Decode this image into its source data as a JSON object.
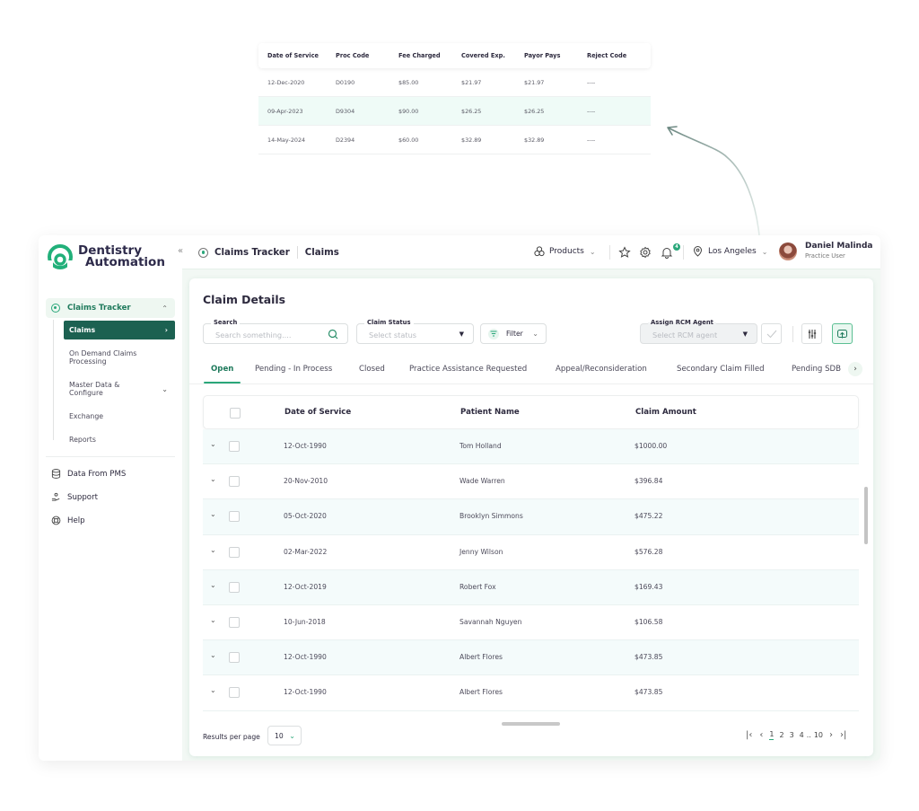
{
  "detail_table": {
    "headers": [
      "Date of Service",
      "Proc Code",
      "Fee Charged",
      "Covered Exp.",
      "Payor Pays",
      "Reject Code"
    ],
    "rows": [
      [
        "12-Dec-2020",
        "D0190",
        "$85.00",
        "$21.97",
        "$21.97",
        "----"
      ],
      [
        "09-Apr-2023",
        "D9304",
        "$90.00",
        "$26.25",
        "$26.25",
        "----"
      ],
      [
        "14-May-2024",
        "D2394",
        "$60.00",
        "$32.89",
        "$32.89",
        "----"
      ]
    ]
  },
  "brand": {
    "line1": "Dentistry",
    "line2": "Automation",
    "accent": "#2aa77a",
    "dark": "#1c6151"
  },
  "sidebar": {
    "collapse_label": "«",
    "group": {
      "label": "Claims Tracker",
      "chevron": "^"
    },
    "sub_items": [
      {
        "label": "Claims",
        "active": true,
        "chevron": ">"
      },
      {
        "label": "On Demand Claims Processing"
      },
      {
        "label": "Master Data & Configure",
        "chevron": "v"
      },
      {
        "label": "Exchange"
      },
      {
        "label": "Reports"
      }
    ],
    "links": [
      {
        "label": "Data From PMS",
        "icon": "database-icon"
      },
      {
        "label": "Support",
        "icon": "support-hand-icon"
      },
      {
        "label": "Help",
        "icon": "lifebuoy-icon"
      }
    ]
  },
  "header": {
    "breadcrumb": [
      "Claims Tracker",
      "Claims"
    ],
    "products_label": "Products",
    "notification_count": "4",
    "location": "Los Angeles",
    "user": {
      "name": "Daniel Malinda",
      "role": "Practice User"
    }
  },
  "main": {
    "title": "Claim Details",
    "search": {
      "legend": "Search",
      "placeholder": "Search something...."
    },
    "claim_status": {
      "legend": "Claim Status",
      "placeholder": "Select status"
    },
    "filter_label": "Filter",
    "rcm_agent": {
      "legend": "Assign RCM Agent",
      "placeholder": "Select RCM agent"
    },
    "tabs": [
      {
        "label": "Open",
        "active": true
      },
      {
        "label": "Pending - In Process"
      },
      {
        "label": "Closed"
      },
      {
        "label": "Practice Assistance Requested"
      },
      {
        "label": "Appeal/Reconsideration"
      },
      {
        "label": "Secondary Claim Filled"
      },
      {
        "label": "Pending SDB"
      }
    ],
    "table": {
      "headers": [
        "Date of Service",
        "Patient Name",
        "Claim Amount"
      ],
      "rows": [
        [
          "12-Oct-1990",
          "Tom Holland",
          "$1000.00"
        ],
        [
          "20-Nov-2010",
          "Wade Warren",
          "$396.84"
        ],
        [
          "05-Oct-2020",
          "Brooklyn Simmons",
          "$475.22"
        ],
        [
          "02-Mar-2022",
          "Jenny Wilson",
          "$576.28"
        ],
        [
          "12-Oct-2019",
          "Robert Fox",
          "$169.43"
        ],
        [
          "10-Jun-2018",
          "Savannah Nguyen",
          "$106.58"
        ],
        [
          "12-Oct-1990",
          "Albert Flores",
          "$473.85"
        ],
        [
          "12-Oct-1990",
          "Albert Flores",
          "$473.85"
        ]
      ]
    },
    "results_per_page_label": "Results per page",
    "results_per_page": "10",
    "pagination": {
      "pages": [
        "1",
        "2",
        "3",
        "4"
      ],
      "ellipsis": "..",
      "last": "10",
      "current": "1"
    }
  }
}
